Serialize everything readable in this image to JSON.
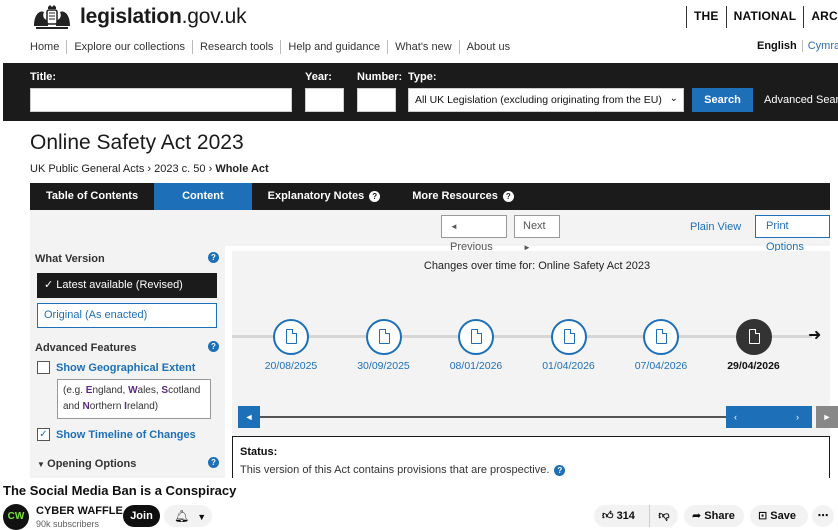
{
  "site": {
    "logo_prefix": "legislation",
    "logo_suffix": ".gov.uk",
    "tna": [
      "THE",
      "NATIONAL",
      "ARCHIVES"
    ]
  },
  "nav": [
    "Home",
    "Explore our collections",
    "Research tools",
    "Help and guidance",
    "What's new",
    "About us"
  ],
  "lang": {
    "english": "English",
    "cymraeg": "Cymraeg"
  },
  "search": {
    "title_label": "Title:",
    "year_label": "Year:",
    "number_label": "Number:",
    "type_label": "Type:",
    "type_value": "All UK Legislation (excluding originating from the EU)",
    "search_button": "Search",
    "advanced": "Advanced Search"
  },
  "page": {
    "title": "Online Safety Act 2023",
    "breadcrumb": [
      "UK Public General Acts",
      "2023 c. 50",
      "Whole Act"
    ]
  },
  "tabs": [
    "Table of Contents",
    "Content",
    "Explanatory Notes",
    "More Resources"
  ],
  "toolbar": {
    "previous": "Previous",
    "next": "Next",
    "plain_view": "Plain View",
    "print_options": "Print Options"
  },
  "sidebar": {
    "what_version": "What Version",
    "latest": "Latest available (Revised)",
    "original": "Original (As enacted)",
    "advanced_features": "Advanced Features",
    "show_geo": "Show Geographical Extent",
    "geo_hint_1": "(e.g. ",
    "geo_E": "E",
    "geo_ngland": "ngland, ",
    "geo_W": "W",
    "geo_ales": "ales, ",
    "geo_S": "S",
    "geo_cotland": "cotland",
    "geo_and": "and ",
    "geo_N": "N",
    "geo_orthern": "orthern ",
    "geo_I": "I",
    "geo_reland": "reland)",
    "show_timeline": "Show Timeline of Changes",
    "opening_options": "Opening Options"
  },
  "timeline": {
    "caption": "Changes over time for: Online Safety Act 2023",
    "dates": [
      "20/08/2025",
      "30/09/2025",
      "08/01/2026",
      "01/04/2026",
      "07/04/2026",
      "29/04/2026"
    ],
    "current_index": 5
  },
  "status": {
    "label": "Status:",
    "message": "This version of this Act contains provisions that are prospective."
  },
  "video": {
    "title": "The Social Media Ban is a Conspiracy",
    "channel": "CYBER WAFFLE",
    "subscribers": "90k subscribers",
    "join": "Join",
    "likes": "314",
    "share": "Share",
    "save": "Save"
  },
  "colors": {
    "brand_blue": "#1d70b8",
    "dark_band": "#1b1b1b",
    "panel_grey": "#f3f3f3"
  }
}
